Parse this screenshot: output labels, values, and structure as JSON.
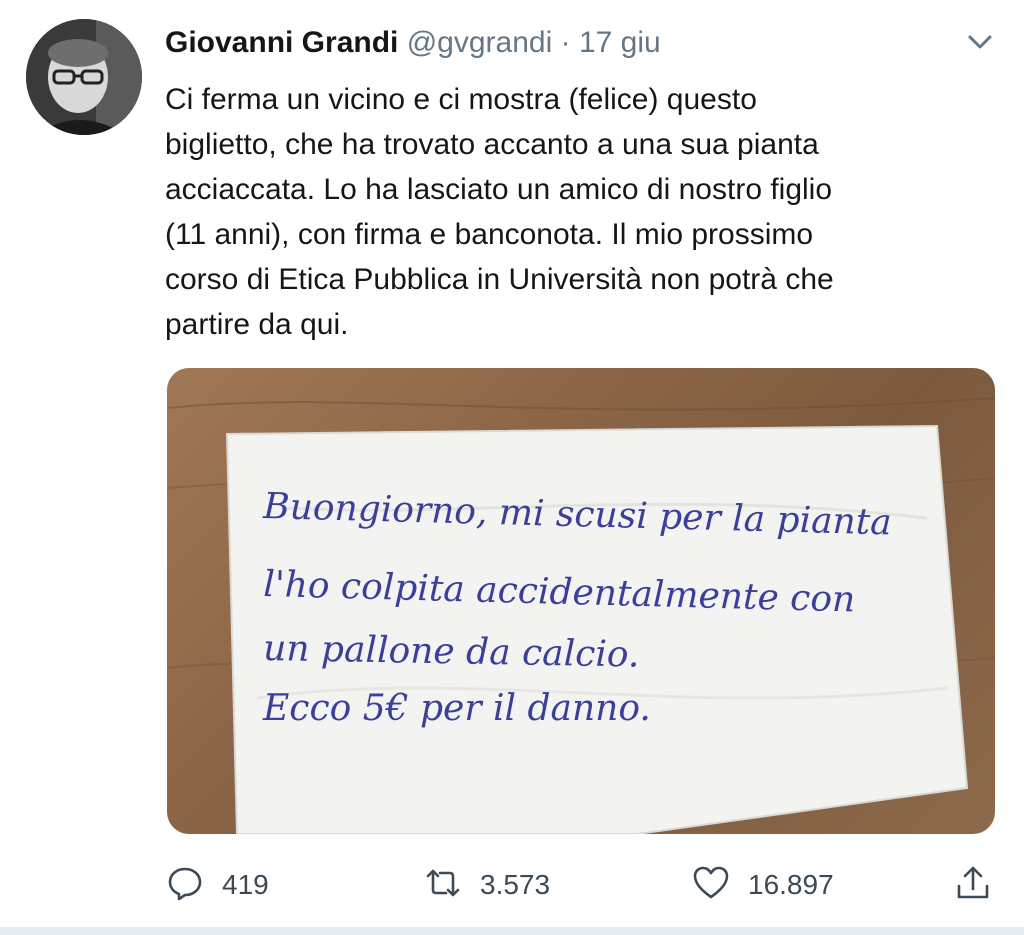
{
  "author": {
    "name": "Giovanni Grandi",
    "handle": "@gvgrandi",
    "separator": "·",
    "date": "17 giu"
  },
  "tweet": {
    "text": "Ci ferma un vicino e ci mostra (felice) questo\nbiglietto, che ha trovato accanto a una sua pianta\nacciaccata. Lo ha lasciato un amico di nostro figlio\n(11 anni), con firma e banconota. Il mio prossimo\ncorso di Etica Pubblica in Università non potrà che\npartire da qui."
  },
  "photo": {
    "note_lines": [
      "Buongiorno, mi scusi per la pianta",
      "l'ho colpita accidentalmente con",
      "un pallone da calcio.",
      "Ecco 5€ per il danno."
    ]
  },
  "actions": {
    "replies": "419",
    "retweets": "3.573",
    "likes": "16.897"
  },
  "icons": {
    "reply": "reply-icon",
    "retweet": "retweet-icon",
    "like": "heart-icon",
    "share": "share-icon",
    "menu": "chevron-down-icon"
  },
  "colors": {
    "text": "#14171a",
    "secondary": "#657786",
    "action_icon": "#3c4a57",
    "handwriting": "#3a3f9a"
  }
}
